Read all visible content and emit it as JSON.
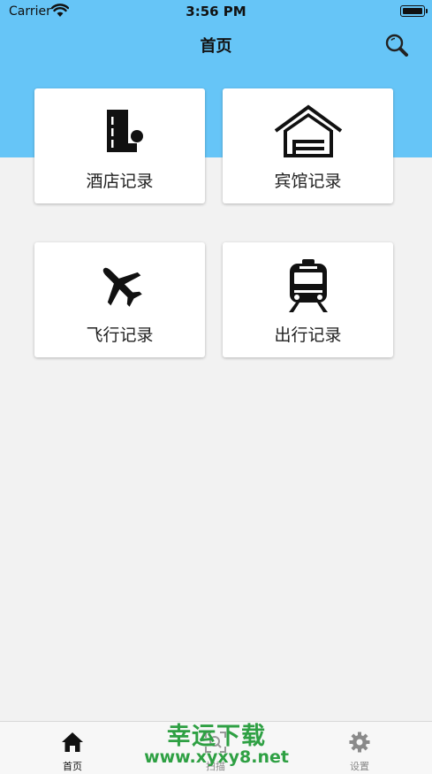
{
  "status_bar": {
    "carrier": "Carrier",
    "time": "3:56 PM"
  },
  "header": {
    "title": "首页",
    "search_icon": "search-icon"
  },
  "colors": {
    "header_bg": "#66c5f7",
    "page_bg": "#f2f2f2",
    "card_bg": "#ffffff",
    "watermark": "#2ea043"
  },
  "cards": [
    {
      "label": "酒店记录",
      "icon": "hotel-building-icon"
    },
    {
      "label": "宾馆记录",
      "icon": "house-icon"
    },
    {
      "label": "飞行记录",
      "icon": "airplane-icon"
    },
    {
      "label": "出行记录",
      "icon": "train-icon"
    }
  ],
  "tabs": [
    {
      "label": "首页",
      "icon": "home-icon",
      "active": true
    },
    {
      "label": "扫描",
      "icon": "scan-icon",
      "active": false
    },
    {
      "label": "设置",
      "icon": "gear-icon",
      "active": false
    }
  ],
  "watermark": {
    "line1": "幸运下载",
    "line2": "www.xyxy8.net"
  }
}
